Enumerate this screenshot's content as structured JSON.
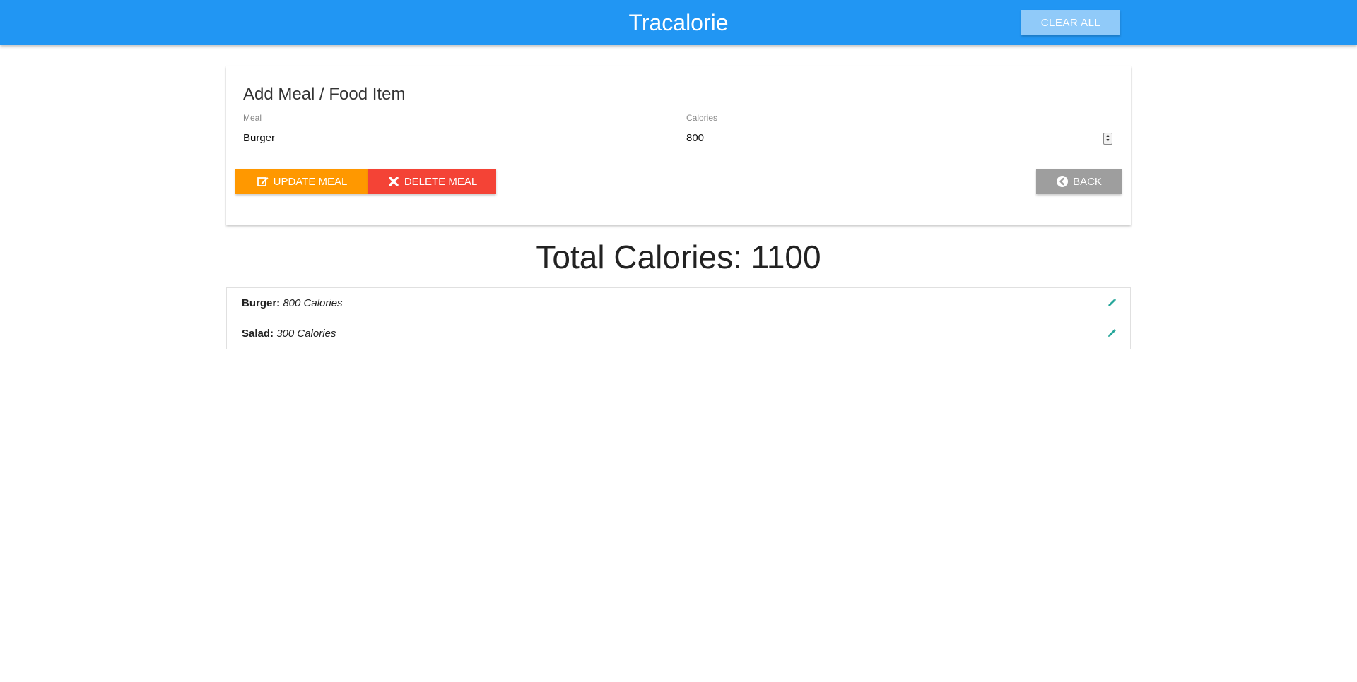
{
  "navbar": {
    "brand": "Tracalorie",
    "clear_all_label": "CLEAR ALL"
  },
  "form": {
    "title": "Add Meal / Food Item",
    "meal_label": "Meal",
    "meal_value": "Burger",
    "calories_label": "Calories",
    "calories_value": "800",
    "update_label": "UPDATE MEAL",
    "delete_label": "DELETE MEAL",
    "back_label": "BACK"
  },
  "total": {
    "text": "Total Calories: 1100"
  },
  "items": [
    {
      "name": "Burger:",
      "calories": "800 Calories"
    },
    {
      "name": "Salad:",
      "calories": "300 Calories"
    }
  ],
  "colors": {
    "navbar": "#2196f3",
    "update": "#ff9800",
    "delete": "#f44336",
    "back": "#9e9e9e",
    "edit_icon": "#26a69a"
  },
  "icons": {
    "update": "edit-icon",
    "delete": "close-icon",
    "back": "chevron-left-circle-icon",
    "item_edit": "pencil-icon"
  }
}
